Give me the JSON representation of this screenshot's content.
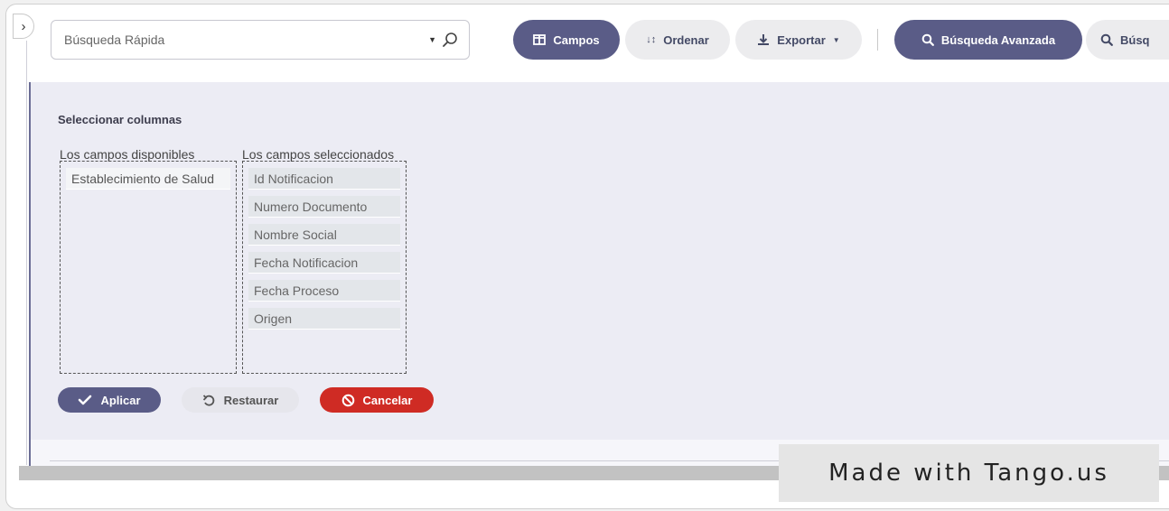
{
  "toolbar": {
    "search_placeholder": "Búsqueda Rápida",
    "campos_label": "Campos",
    "ordenar_label": "Ordenar",
    "exportar_label": "Exportar",
    "busqueda_avanzada_label": "Búsqueda Avanzada",
    "busqueda_truncated_label": "Búsq"
  },
  "column_selector": {
    "title": "Seleccionar columnas",
    "available_label": "Los campos disponibles",
    "selected_label": "Los campos seleccionados",
    "available_items": [
      "Establecimiento de Salud"
    ],
    "selected_items": [
      "Id Notificacion",
      "Numero Documento",
      "Nombre Social",
      "Fecha Notificacion",
      "Fecha Proceso",
      "Origen"
    ]
  },
  "actions": {
    "apply_label": "Aplicar",
    "restore_label": "Restaurar",
    "cancel_label": "Cancelar"
  },
  "watermark": "Made with Tango.us",
  "colors": {
    "primary": "#5a5c87",
    "danger": "#cf2b24",
    "panel_bg": "#ececf4"
  }
}
